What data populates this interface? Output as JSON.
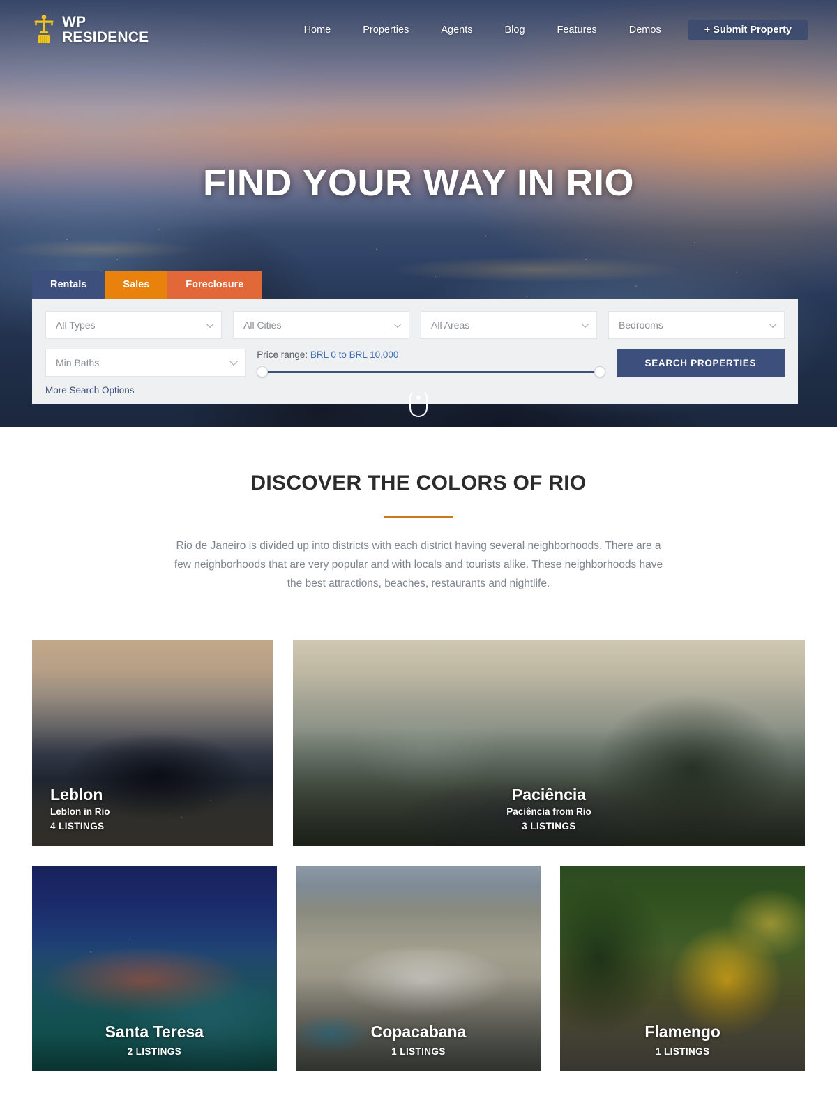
{
  "header": {
    "logo": {
      "icon": "christ-redeemer-icon",
      "line1": "WP",
      "line2": "RESIDENCE"
    },
    "nav": [
      {
        "label": "Home"
      },
      {
        "label": "Properties"
      },
      {
        "label": "Agents"
      },
      {
        "label": "Blog"
      },
      {
        "label": "Features"
      },
      {
        "label": "Demos"
      }
    ],
    "submit_label": "+ Submit Property"
  },
  "hero": {
    "title": "FIND YOUR WAY IN RIO",
    "scroll_indicator": "mouse-scroll-icon"
  },
  "search": {
    "tabs": [
      {
        "label": "Rentals",
        "active": true,
        "color": "#3d4f7c"
      },
      {
        "label": "Sales",
        "active": false,
        "color": "#e8820c"
      },
      {
        "label": "Foreclosure",
        "active": false,
        "color": "#e2683a"
      }
    ],
    "fields": {
      "type": "All Types",
      "city": "All Cities",
      "area": "All Areas",
      "bedrooms": "Bedrooms",
      "baths": "Min Baths"
    },
    "price": {
      "label": "Price range:",
      "value": "BRL 0 to BRL 10,000",
      "min": 0,
      "max": 10000
    },
    "search_button": "SEARCH PROPERTIES",
    "more_options": "More Search Options"
  },
  "discover": {
    "heading": "DISCOVER THE COLORS OF RIO",
    "body": "Rio de Janeiro is divided up into districts with each district having several neighborhoods. There are a few neighborhoods that are very popular and with locals and tourists alike. These neighborhoods have the best attractions, beaches, restaurants and nightlife."
  },
  "cards": {
    "row1": [
      {
        "title": "Leblon",
        "subtitle": "Leblon in Rio",
        "count": "4 LISTINGS",
        "align": "left"
      },
      {
        "title": "Paciência",
        "subtitle": "Paciência from Rio",
        "count": "3 LISTINGS",
        "align": "center"
      }
    ],
    "row2": [
      {
        "title": "Santa Teresa",
        "subtitle": "",
        "count": "2 LISTINGS",
        "align": "center"
      },
      {
        "title": "Copacabana",
        "subtitle": "",
        "count": "1 LISTINGS",
        "align": "center"
      },
      {
        "title": "Flamengo",
        "subtitle": "",
        "count": "1 LISTINGS",
        "align": "center"
      }
    ]
  },
  "colors": {
    "brand_blue": "#3d4f7c",
    "accent_orange": "#e8820c",
    "accent_red_orange": "#e2683a",
    "rule_gold": "#c77a1e",
    "link_blue": "#3d6fb0",
    "body_text": "#7e8490"
  }
}
